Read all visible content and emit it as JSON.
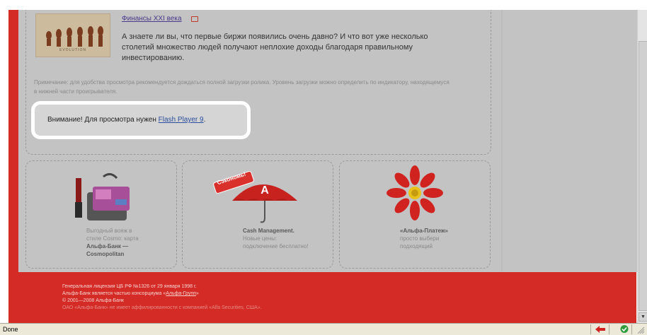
{
  "article": {
    "title": "Финансы XXI века",
    "text": "А знаете ли вы, что первые биржи появились очень давно? И что вот уже несколько столетий множество людей получают неплохие доходы благодаря правильному инвестированию.",
    "thumb_caption": "EVOLUTION"
  },
  "note": "Примечание: для удобства просмотра рекомендуется дождаться полной загрузки ролика. Уровень загрузки можно определить по индикатору, находящемуся в нижней части проигрывателя.",
  "flash": {
    "prefix": "Внимание! Для просмотра нужен ",
    "link": "Flash Player 9",
    "suffix": "."
  },
  "promos": [
    {
      "line1": "Выгодный вояж в",
      "line2": "стиле Cosmo: карта",
      "bold1": "Альфа-Банк —",
      "bold2": "Cosmopolitan"
    },
    {
      "badge": "Сэкономь!",
      "title": "Cash Management.",
      "line1": "Новые цены:",
      "line2": "подключение бесплатно!"
    },
    {
      "title": "«Альфа-Платеж»",
      "line1": "просто выбери",
      "line2": "подходящий"
    }
  ],
  "footer": {
    "line1": "Генеральная лицензия ЦБ РФ №1326 от 29 января 1998 г.",
    "line2_prefix": "Альфа-Банк является частью консорциума «",
    "line2_link": "Альфа-Групп",
    "line2_suffix": "»",
    "line3": "© 2001—2008 Альфа-Банк",
    "line4": "ОАО «Альфа-Банк» не имеет аффилированности с компанией «Alfa Securities, США»."
  },
  "status": {
    "text": "Done"
  },
  "colors": {
    "brand_red": "#d52b27",
    "content_gray": "#c3c3c3"
  }
}
